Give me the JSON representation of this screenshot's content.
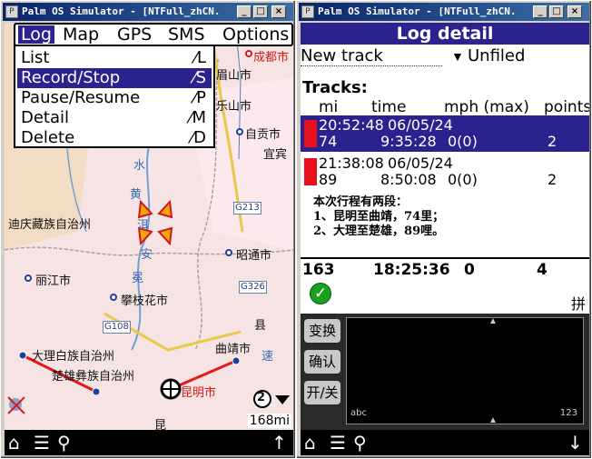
{
  "left_window": {
    "title": "Palm OS Simulator - [NTFull_zhCN.",
    "buttons": {
      "minimize": "_",
      "maximize": "□",
      "close": "×"
    },
    "menubar": {
      "items": [
        "Log",
        "Map",
        "GPS",
        "SMS",
        "Options"
      ]
    },
    "menu": {
      "items": [
        {
          "label": "List",
          "shortcut": "⁄L"
        },
        {
          "label": "Record/Stop",
          "shortcut": "⁄S"
        },
        {
          "label": "Pause/Resume",
          "shortcut": "⁄P"
        },
        {
          "label": "Detail",
          "shortcut": "⁄M"
        },
        {
          "label": "Delete",
          "shortcut": "⁄D"
        }
      ],
      "selected": "Record/Stop"
    },
    "map": {
      "cities": [
        "成都市",
        "眉山市",
        "乐山市",
        "自贡市",
        "宜宾",
        "迪庆藏族自治州",
        "昭通市",
        "丽江市",
        "攀枝花市",
        "大理白族自治州",
        "楚雄彝族自治州",
        "曲靖市",
        "昆明市"
      ],
      "misc_labels": [
        "水",
        "黄",
        "洱",
        "安",
        "冕",
        "速",
        "县",
        "昆"
      ],
      "roads": [
        "G213",
        "G326",
        "G108"
      ],
      "scale": "168mi",
      "zoom_badge": "2"
    },
    "bottom_icons": [
      "home-icon",
      "menu-down-icon",
      "search-icon",
      "up-arrow-icon"
    ]
  },
  "right_window": {
    "title": "Palm OS Simulator - [NTFull_zhCN.",
    "header": "Log detail",
    "name_field": "New track",
    "category": "Unfiled",
    "tracks_label": "Tracks:",
    "columns": [
      "mi",
      "time",
      "mph (max)",
      "points"
    ],
    "rows": [
      {
        "start": "20:52:48",
        "date": "06/05/24",
        "mi": "74",
        "time": "9:35:28",
        "mph": "0(0)",
        "points": "2",
        "selected": true
      },
      {
        "start": "21:38:08",
        "date": "06/05/24",
        "mi": "89",
        "time": "8:50:08",
        "mph": "0(0)",
        "points": "2",
        "selected": false
      }
    ],
    "note_lines": [
      "本次行程有两段：",
      "1、昆明至曲靖，74里；",
      "2、大理至楚雄，89哩。"
    ],
    "totals": {
      "mi": "163",
      "time": "18:25:36",
      "mph": "0",
      "points": "4"
    },
    "ime_mode": "拼",
    "ime_buttons": [
      "变换",
      "确认",
      "开/关"
    ],
    "ime_pad_labels": [
      "abc",
      "123"
    ]
  }
}
